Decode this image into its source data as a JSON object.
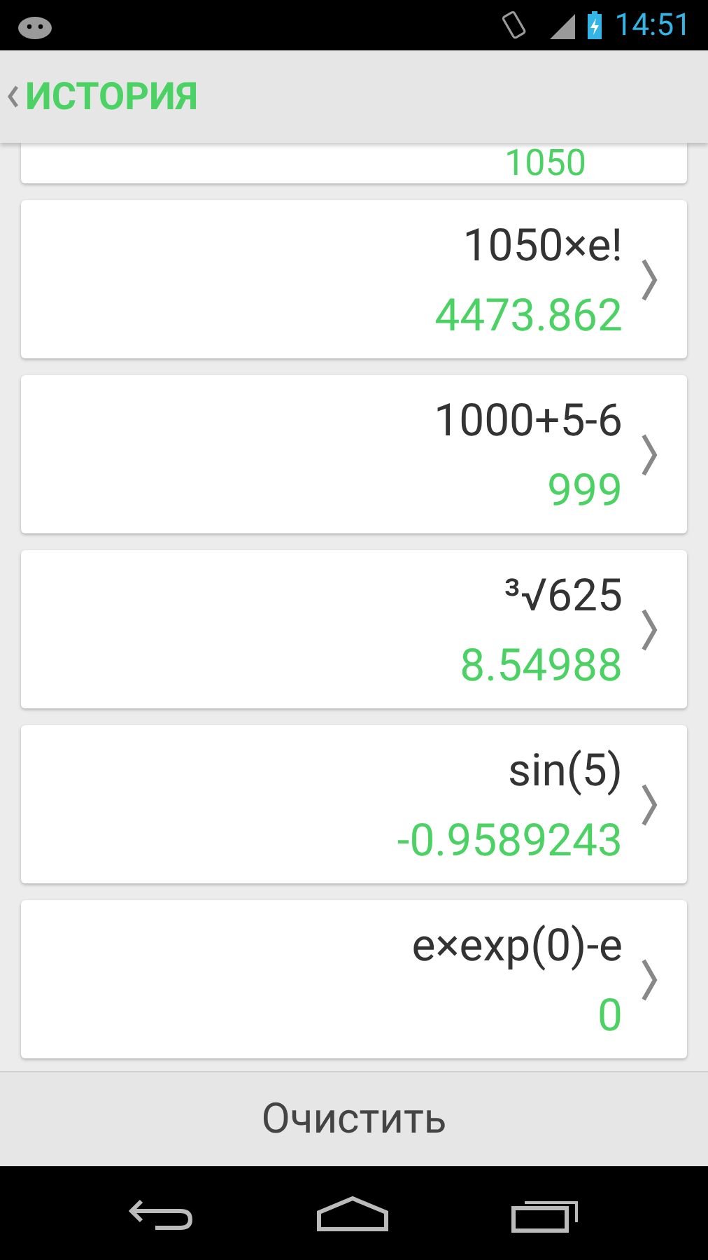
{
  "status_bar": {
    "time": "14:51"
  },
  "action_bar": {
    "title": "ИСТОРИЯ"
  },
  "partial_item": {
    "result": "1050"
  },
  "history": [
    {
      "expression": "1050×e!",
      "result": "4473.862"
    },
    {
      "expression": "1000+5-6",
      "result": "999"
    },
    {
      "expression": "³√625",
      "result": "8.54988"
    },
    {
      "expression": "sin(5)",
      "result": "-0.9589243"
    },
    {
      "expression": "e×exp(0)-e",
      "result": "0"
    }
  ],
  "clear_button": "Очистить"
}
